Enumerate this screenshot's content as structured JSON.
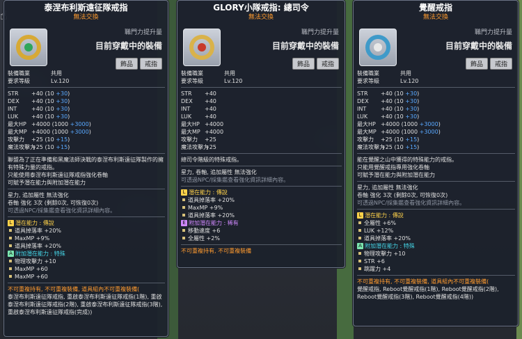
{
  "cards": [
    {
      "title": "泰涅布利斯遠征隊戒指",
      "subtitle": "無法交換",
      "boost_label": "職門力提升量",
      "equipped_label": "目前穿戴中的裝備",
      "tags": [
        "飾品",
        "戒指"
      ],
      "job_label": "裝備職業",
      "job_value": "共用",
      "level_label": "要求等級",
      "level_value": "Lv.120",
      "stats": [
        {
          "name": "STR",
          "base": "+40",
          "detail": "(10 ",
          "extra": "+30",
          "close": ")"
        },
        {
          "name": "DEX",
          "base": "+40",
          "detail": "(10 ",
          "extra": "+30",
          "close": ")"
        },
        {
          "name": "INT",
          "base": "+40",
          "detail": "(10 ",
          "extra": "+30",
          "close": ")"
        },
        {
          "name": "LUK",
          "base": "+40",
          "detail": "(10 ",
          "extra": "+30",
          "close": ")"
        },
        {
          "name": "最大HP",
          "base": "+4000",
          "detail": "(1000 ",
          "extra": "+3000",
          "close": ")"
        },
        {
          "name": "最大MP",
          "base": "+4000",
          "detail": "(1000 ",
          "extra": "+3000",
          "close": ")"
        },
        {
          "name": "攻擊力",
          "base": "+25",
          "detail": "(10 ",
          "extra": "+15",
          "close": ")"
        },
        {
          "name": "魔法攻擊力",
          "base": "+25",
          "detail": "(10 ",
          "extra": "+15",
          "close": ")"
        }
      ],
      "desc": [
        "聯盟為了正在準備和黑魔法師決戰的泰涅布利斯遠征隊製作的擁有特殊力量的戒指。",
        "只能使用泰涅布利斯遠征隊戒指強化卷軸",
        "可賦予潛在能力與附加潛在能力"
      ],
      "attr_lines": [
        "星力, 追加屬性 無法強化",
        "卷軸 強化 3次 (剩餘0次, 可恢復0次)"
      ],
      "attr_note": "可透過NPC/採集鑑查看強化資訊詳細內容。",
      "potential_label": "潛在能力 : 傳說",
      "potential": [
        "道具掉落率 +20%",
        "MaxMP +9%",
        "道具掉落率 +20%"
      ],
      "add_potential_label": "附加潛在能力 : 特殊",
      "add_potential": [
        "物理攻擊力 +10",
        "MaxMP +60",
        "MaxMP +60"
      ],
      "warning": "不可重複持有, 不可重複裝備, 道具組內不可重複裝備(",
      "set_text": "泰涅布利斯遠征隊戒指, 重啟泰涅布利斯遠征隊戒指(1階), 重啟泰涅布利斯遠征隊戒指(2階), 重啟泰涅布利斯遠征隊戒指(3階), 重啟泰涅布利斯遠征隊戒指(完成))"
    },
    {
      "title": "GLORY小隊戒指: 總司令",
      "subtitle": "無法交換",
      "boost_label": "職門力提升量",
      "equipped_label": "目前穿戴中的裝備",
      "tags": [
        "飾品",
        "戒指"
      ],
      "job_label": "裝備職業",
      "job_value": "共用",
      "level_label": "要求等級",
      "level_value": "Lv.120",
      "stats": [
        {
          "name": "STR",
          "base": "+40",
          "detail": "",
          "extra": "",
          "close": ""
        },
        {
          "name": "DEX",
          "base": "+40",
          "detail": "",
          "extra": "",
          "close": ""
        },
        {
          "name": "INT",
          "base": "+40",
          "detail": "",
          "extra": "",
          "close": ""
        },
        {
          "name": "LUK",
          "base": "+40",
          "detail": "",
          "extra": "",
          "close": ""
        },
        {
          "name": "最大HP",
          "base": "+4000",
          "detail": "",
          "extra": "",
          "close": ""
        },
        {
          "name": "最大MP",
          "base": "+4000",
          "detail": "",
          "extra": "",
          "close": ""
        },
        {
          "name": "攻擊力",
          "base": "+25",
          "detail": "",
          "extra": "",
          "close": ""
        },
        {
          "name": "魔法攻擊力",
          "base": "+25",
          "detail": "",
          "extra": "",
          "close": ""
        }
      ],
      "desc": [
        "總司令階級的特殊戒指。"
      ],
      "attr_lines": [
        "星力, 卷軸, 追加屬性 無法強化"
      ],
      "attr_note": "可透過NPC/採集鑑查看強化資訊詳細內容。",
      "potential_label": "潛在能力 : 傳說",
      "potential": [
        "道具掉落率 +20%",
        "MaxMP +9%",
        "道具掉落率 +20%"
      ],
      "add_potential_label": "附加潛在能力 : 稀有",
      "add_potential": [
        "移動速度 +6",
        "全屬性 +2%"
      ],
      "warning": "不可重複持有, 不可重複裝備",
      "set_text": ""
    },
    {
      "title": "覺醒戒指",
      "subtitle": "無法交換",
      "boost_label": "職門力提升量",
      "equipped_label": "目前穿戴中的裝備",
      "tags": [
        "飾品",
        "戒指"
      ],
      "job_label": "裝備職業",
      "job_value": "共用",
      "level_label": "要求等級",
      "level_value": "Lv.120",
      "stats": [
        {
          "name": "STR",
          "base": "+40",
          "detail": "(10 ",
          "extra": "+30",
          "close": ")"
        },
        {
          "name": "DEX",
          "base": "+40",
          "detail": "(10 ",
          "extra": "+30",
          "close": ")"
        },
        {
          "name": "INT",
          "base": "+40",
          "detail": "(10 ",
          "extra": "+30",
          "close": ")"
        },
        {
          "name": "LUK",
          "base": "+40",
          "detail": "(10 ",
          "extra": "+30",
          "close": ")"
        },
        {
          "name": "最大HP",
          "base": "+4000",
          "detail": "(1000 ",
          "extra": "+3000",
          "close": ")"
        },
        {
          "name": "最大MP",
          "base": "+4000",
          "detail": "(1000 ",
          "extra": "+3000",
          "close": ")"
        },
        {
          "name": "攻擊力",
          "base": "+25",
          "detail": "(10 ",
          "extra": "+15",
          "close": ")"
        },
        {
          "name": "魔法攻擊力",
          "base": "+25",
          "detail": "(10 ",
          "extra": "+15",
          "close": ")"
        }
      ],
      "desc": [
        "能在覺醒之山中獲得的特殊能力的戒指。",
        "只能用覺醒戒指專用強化卷軸",
        "可賦予潛在能力與附加潛在能力"
      ],
      "attr_lines": [
        "星力, 追加屬性 無法強化",
        "卷軸 強化 3次 (剩餘0次, 可恢復0次)"
      ],
      "attr_note": "可透過NPC/採集鑑查看強化資訊詳細內容。",
      "potential_label": "潛在能力 : 傳說",
      "potential": [
        "全屬性 +6%",
        "LUK +12%",
        "道具掉落率 +20%"
      ],
      "add_potential_label": "附加潛在能力 : 特殊",
      "add_potential": [
        "物理攻擊力 +10",
        "STR +6",
        "跳躍力 +4"
      ],
      "warning": "不可重複持有, 不可重複裝備, 道具組內不可重複裝備(",
      "set_text": "覺醒戒指, Reboot覺醒戒指(1階), Reboot覺醒戒指(2階), Reboot覺醒戒指(3階), Reboot覺醒戒指(4階))"
    }
  ],
  "potential_badge": "L",
  "epic_badge": "E",
  "add_badge": "A"
}
